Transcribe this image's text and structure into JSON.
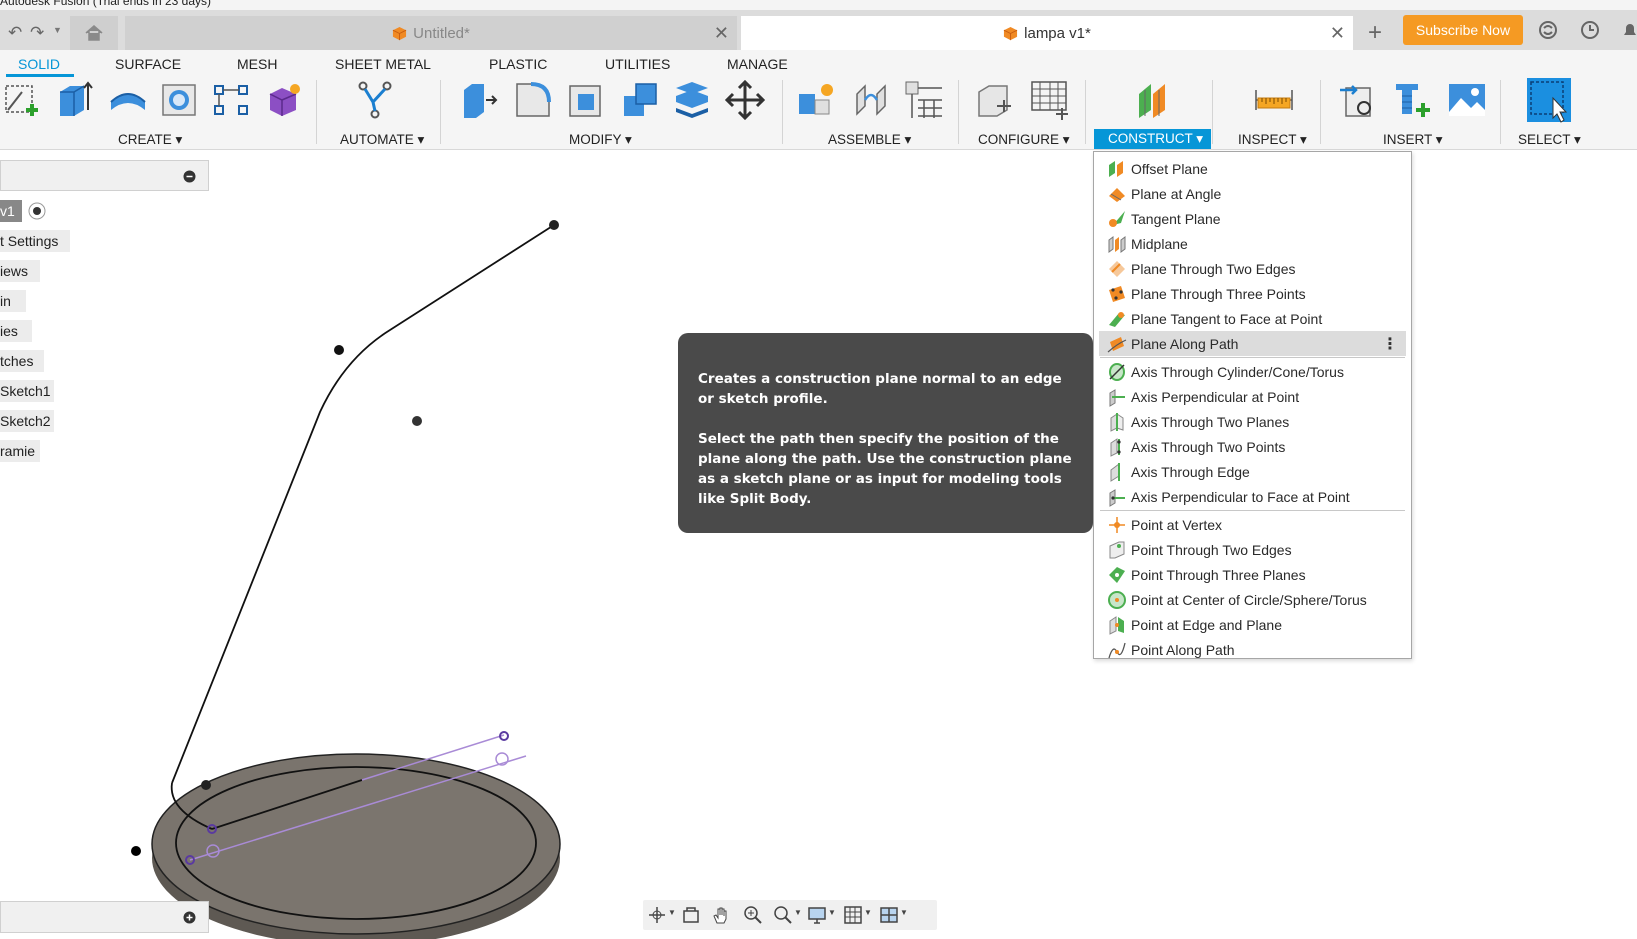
{
  "window": {
    "title": "Autodesk Fusion (Trial ends in 23 days)"
  },
  "tabs": [
    {
      "label": "Untitled*",
      "active": false
    },
    {
      "label": "lampa v1*",
      "active": true
    }
  ],
  "subscribe_label": "Subscribe Now",
  "workspace_tabs": [
    "SOLID",
    "SURFACE",
    "MESH",
    "SHEET METAL",
    "PLASTIC",
    "UTILITIES",
    "MANAGE"
  ],
  "groups": {
    "create": "CREATE ▾",
    "automate": "AUTOMATE ▾",
    "modify": "MODIFY ▾",
    "assemble": "ASSEMBLE ▾",
    "configure": "CONFIGURE ▾",
    "construct": "CONSTRUCT ▾",
    "inspect": "INSPECT ▾",
    "insert": "INSERT ▾",
    "select": "SELECT ▾"
  },
  "browser": {
    "items": [
      "v1",
      "t Settings",
      "iews",
      "in",
      "ies",
      "tches",
      "Sketch1",
      "Sketch2",
      "ramie"
    ]
  },
  "construct_menu": {
    "planes": [
      "Offset Plane",
      "Plane at Angle",
      "Tangent Plane",
      "Midplane",
      "Plane Through Two Edges",
      "Plane Through Three Points",
      "Plane Tangent to Face at Point",
      "Plane Along Path"
    ],
    "axes": [
      "Axis Through Cylinder/Cone/Torus",
      "Axis Perpendicular at Point",
      "Axis Through Two Planes",
      "Axis Through Two Points",
      "Axis Through Edge",
      "Axis Perpendicular to Face at Point"
    ],
    "points": [
      "Point at Vertex",
      "Point Through Two Edges",
      "Point Through Three Planes",
      "Point at Center of Circle/Sphere/Torus",
      "Point at Edge and Plane",
      "Point Along Path"
    ],
    "highlighted": "Plane Along Path"
  },
  "tooltip": {
    "line1": "Creates a construction plane normal to an edge or sketch profile.",
    "line2": "Select the path then specify the position of the plane along the path. Use the construction plane as a sketch plane or as input for modeling tools like Split Body."
  },
  "colors": {
    "accent": "#0696d7",
    "subscribe": "#f59a23",
    "tooltip_bg": "#4a4a4a",
    "body_fill": "#7a746d"
  }
}
